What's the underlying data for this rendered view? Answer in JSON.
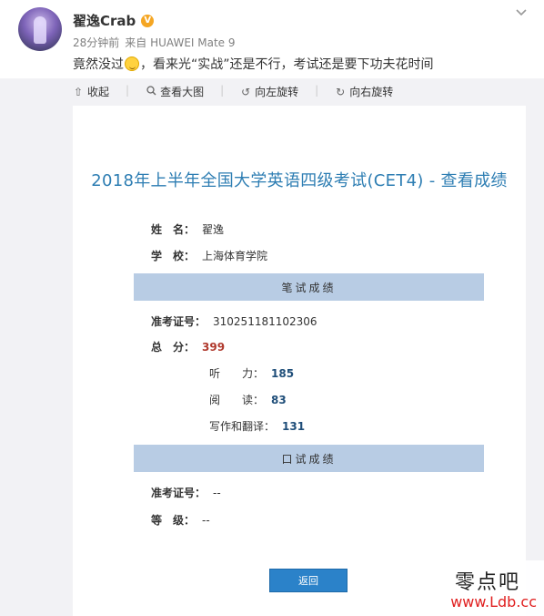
{
  "post": {
    "author": "翟逸Crab",
    "verified_badge": "V",
    "time": "28分钟前",
    "source": "来自 HUAWEI Mate 9",
    "text_before_emoji": "竟然没过",
    "text_after_emoji": "，看来光“实战”还是不行，考试还是要下功夫花时间",
    "collapse_icon": "chevron-down-icon"
  },
  "toolbar": {
    "collapse": "收起",
    "view_large": "查看大图",
    "rotate_left": "向左旋转",
    "rotate_right": "向右旋转"
  },
  "result": {
    "title": "2018年上半年全国大学英语四级考试(CET4) - 查看成绩",
    "name_label": "姓　名：",
    "name_value": "翟逸",
    "school_label": "学　校：",
    "school_value": "上海体育学院",
    "written_header": "笔试成绩",
    "ticket_label": "准考证号：",
    "ticket_value": "310251181102306",
    "total_label": "总　分：",
    "total_value": "399",
    "listening_label": "听　　力：",
    "listening_value": "185",
    "reading_label": "阅　　读：",
    "reading_value": "83",
    "writing_label": "写作和翻译：",
    "writing_value": "131",
    "oral_header": "口试成绩",
    "oral_ticket_label": "准考证号：",
    "oral_ticket_value": "--",
    "grade_label": "等　级：",
    "grade_value": "--",
    "back_button": "返回"
  },
  "watermark": {
    "top": "零点吧",
    "url": "www.Ldb.cc"
  },
  "colors": {
    "title": "#2e7eb3",
    "band": "#b8cce4",
    "total_score": "#b03a2e",
    "section_score": "#1f4e79",
    "button": "#2b82c9",
    "watermark_url": "#e02020"
  }
}
